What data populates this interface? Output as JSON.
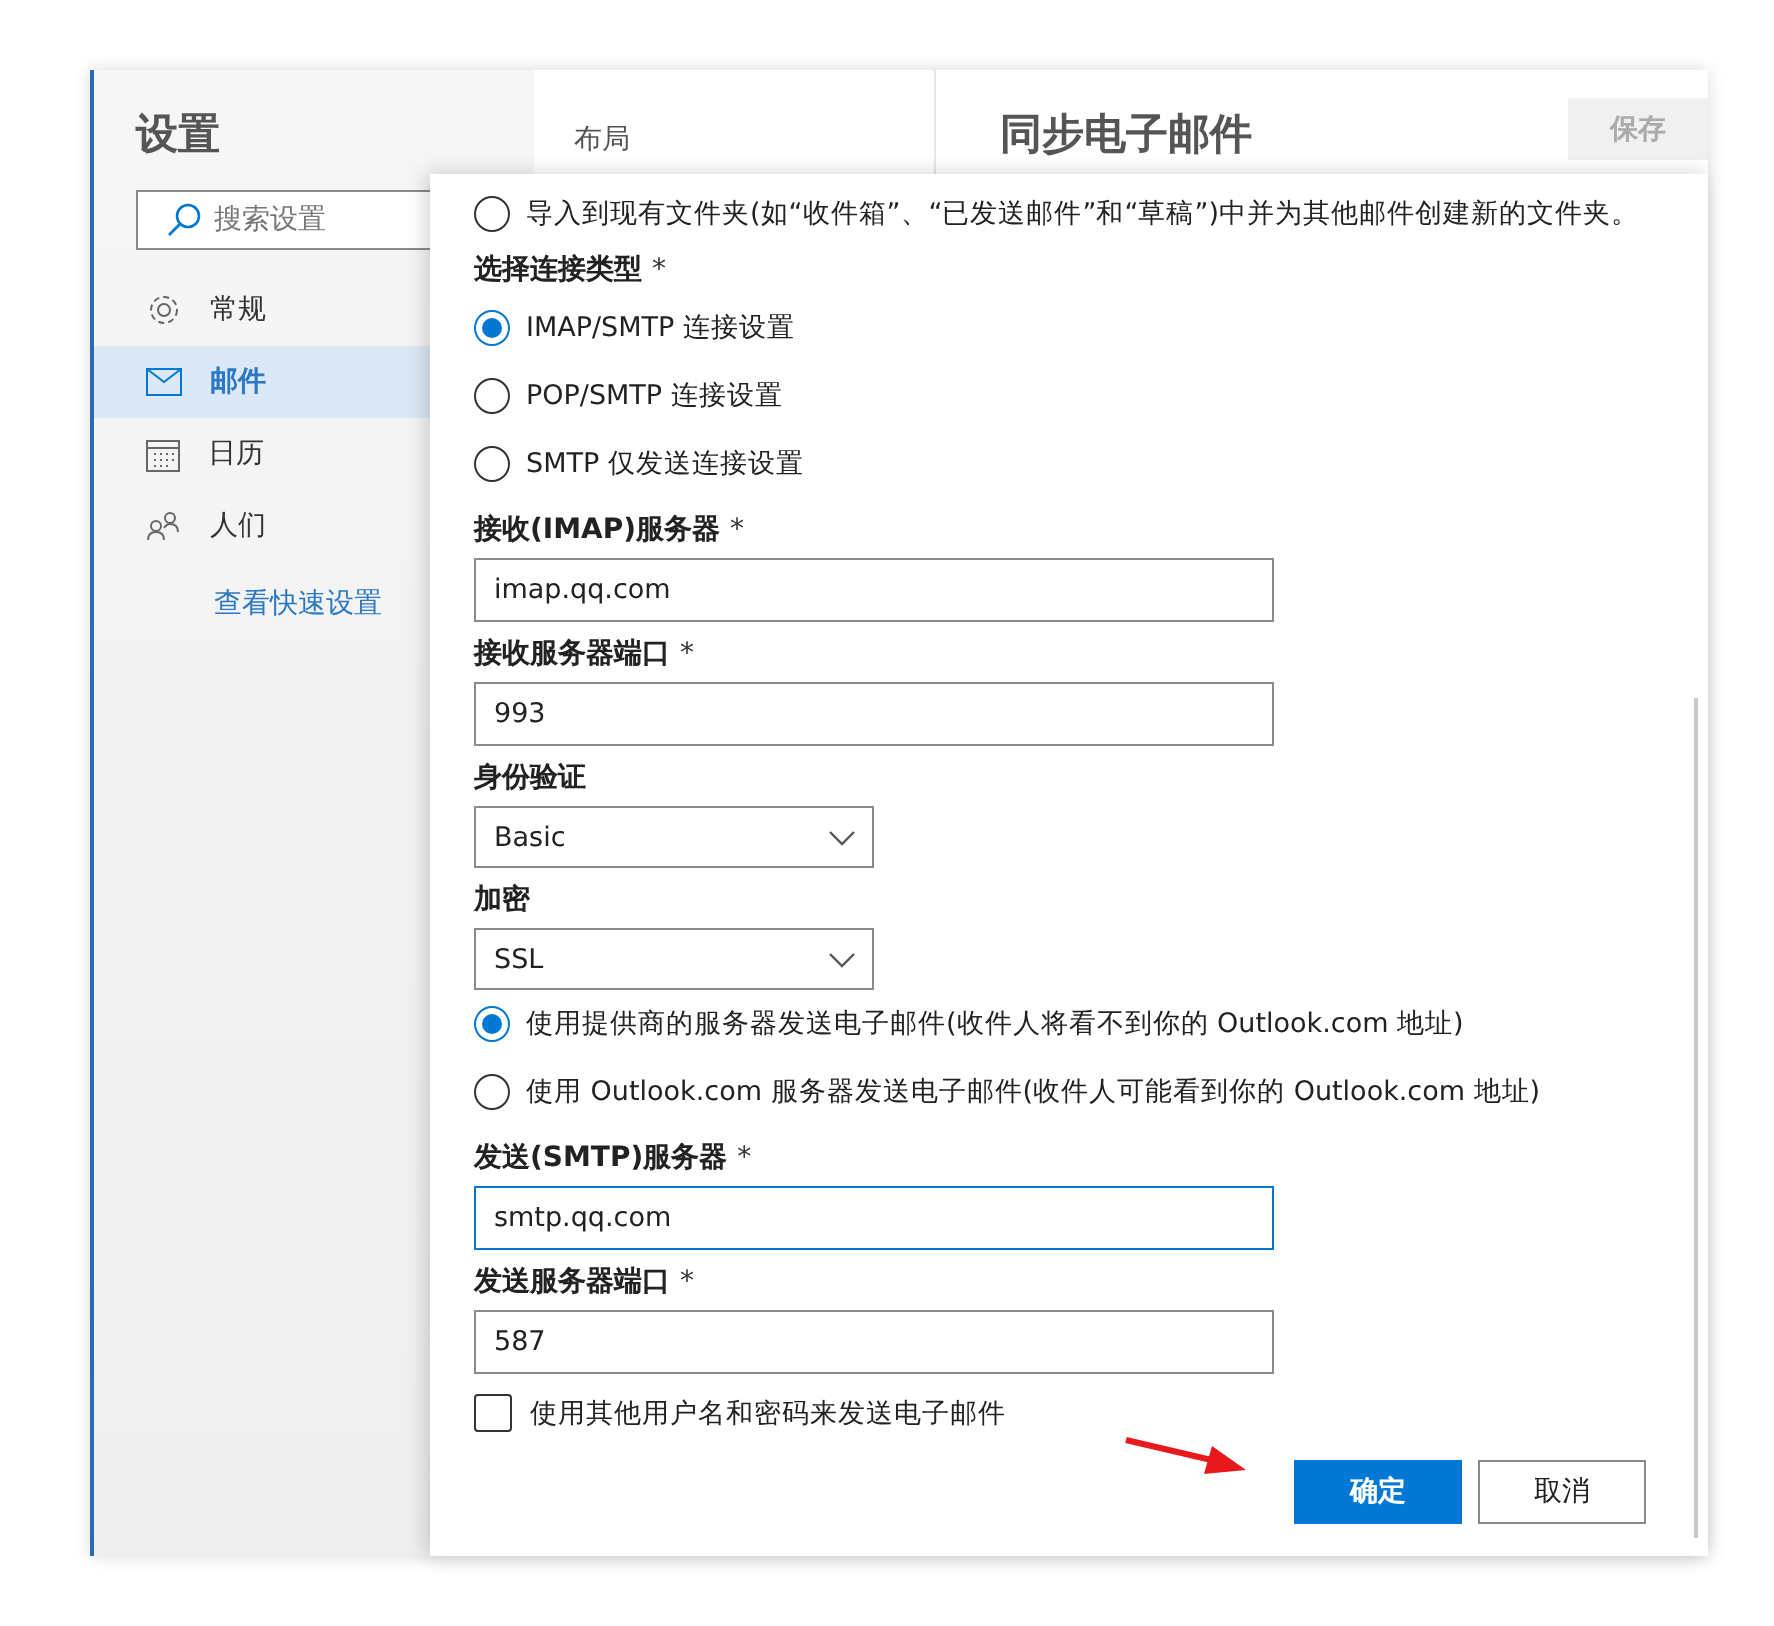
{
  "sidebar": {
    "title": "设置",
    "search": {
      "placeholder": "搜索设置"
    },
    "items": [
      {
        "kind": "gear",
        "label": "常规",
        "selected": false
      },
      {
        "kind": "mail",
        "label": "邮件",
        "selected": true
      },
      {
        "kind": "calendar",
        "label": "日历",
        "selected": false
      },
      {
        "kind": "people",
        "label": "人们",
        "selected": false
      }
    ],
    "link": "查看快速设置"
  },
  "middle": {
    "items": [
      "布局"
    ]
  },
  "header": {
    "title": "同步电子邮件",
    "save_button": {
      "label": "保存",
      "disabled": true
    }
  },
  "dialog": {
    "fields": [
      {
        "kind": "radio",
        "label": "导入到现有文件夹(如“收件箱”、“已发送邮件”和“草稿”)中并为其他邮件创建新的文件夹。",
        "selected": false
      },
      {
        "kind": "label",
        "text": "选择连接类型",
        "mark": "*"
      },
      {
        "kind": "radio",
        "label": "IMAP/SMTP 连接设置",
        "selected": true
      },
      {
        "kind": "radio",
        "label": "POP/SMTP 连接设置",
        "selected": false
      },
      {
        "kind": "radio",
        "label": "SMTP 仅发送连接设置",
        "selected": false
      },
      {
        "kind": "label",
        "text": "接收(IMAP)服务器",
        "mark": "*"
      },
      {
        "kind": "text",
        "value": "imap.qq.com",
        "focused": false
      },
      {
        "kind": "label",
        "text": "接收服务器端口",
        "mark": "*"
      },
      {
        "kind": "text",
        "value": "993",
        "focused": false
      },
      {
        "kind": "label",
        "text": "身份验证"
      },
      {
        "kind": "select",
        "value": "Basic"
      },
      {
        "kind": "label",
        "text": "加密"
      },
      {
        "kind": "select",
        "value": "SSL"
      },
      {
        "kind": "radio",
        "label": "使用提供商的服务器发送电子邮件(收件人将看不到你的 Outlook.com 地址)",
        "selected": true
      },
      {
        "kind": "radio",
        "label": "使用 Outlook.com 服务器发送电子邮件(收件人可能看到你的 Outlook.com 地址)",
        "selected": false
      },
      {
        "kind": "label",
        "text": "发送(SMTP)服务器",
        "mark": "*"
      },
      {
        "kind": "text",
        "value": "smtp.qq.com",
        "focused": true
      },
      {
        "kind": "label",
        "text": "发送服务器端口",
        "mark": "*"
      },
      {
        "kind": "text",
        "value": "587",
        "focused": false
      },
      {
        "kind": "checkbox",
        "label": "使用其他用户名和密码来发送电子邮件",
        "checked": false
      }
    ],
    "buttons": [
      {
        "label": "确定",
        "primary": true
      },
      {
        "label": "取消",
        "primary": false
      }
    ]
  }
}
